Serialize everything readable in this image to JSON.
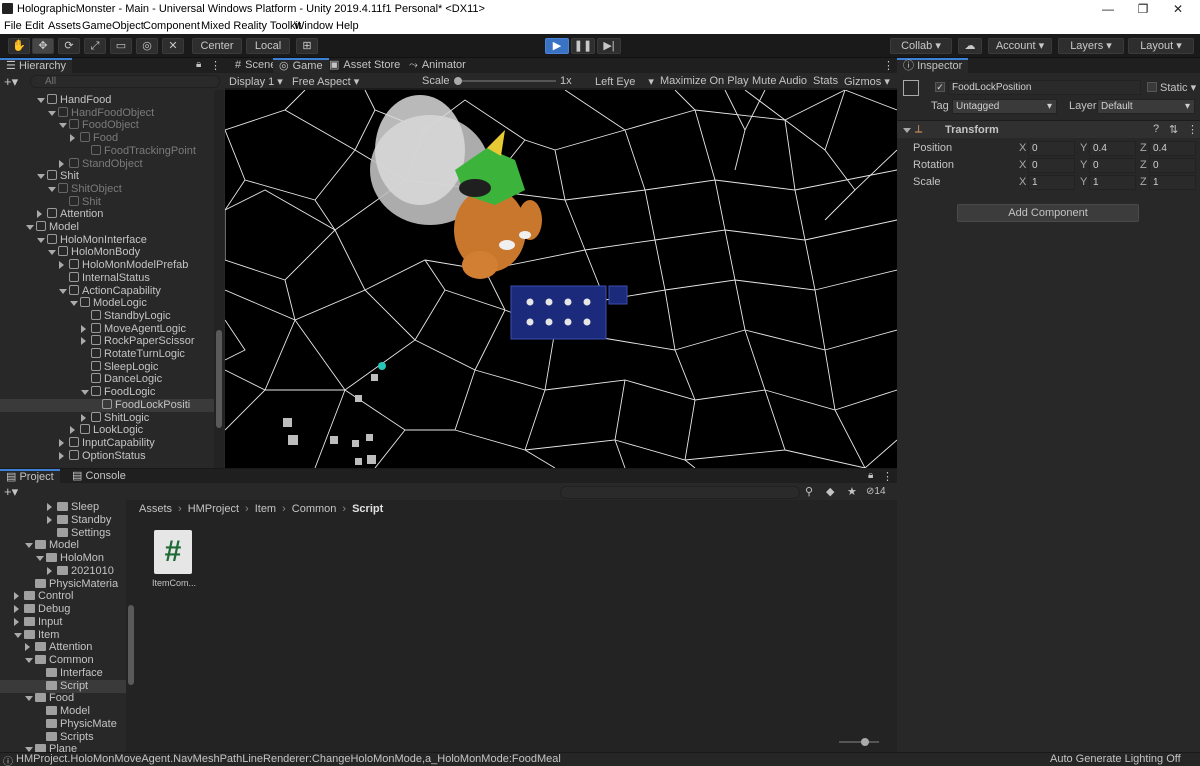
{
  "title_bar": {
    "text": "HolographicMonster - Main - Universal Windows Platform - Unity 2019.4.11f1 Personal* <DX11>",
    "minimize": "—",
    "maximize": "❐",
    "close": "✕"
  },
  "menu": [
    "File",
    "Edit",
    "Assets",
    "GameObject",
    "Component",
    "Mixed Reality Toolkit",
    "Window",
    "Help"
  ],
  "toolbar": {
    "pivot": "Center",
    "space": "Local",
    "collab": "Collab",
    "account": "Account",
    "layers": "Layers",
    "layout": "Layout"
  },
  "hierarchy": {
    "tab": "Hierarchy",
    "search_placeholder": "All",
    "add": "+",
    "rows": [
      {
        "label": "HandFood",
        "indent": 4,
        "arrow": "down",
        "dim": false
      },
      {
        "label": "HandFoodObject",
        "indent": 5,
        "arrow": "down",
        "dim": true
      },
      {
        "label": "FoodObject",
        "indent": 6,
        "arrow": "down",
        "dim": true
      },
      {
        "label": "Food",
        "indent": 7,
        "arrow": "right",
        "dim": true
      },
      {
        "label": "FoodTrackingPoint",
        "indent": 8,
        "arrow": "",
        "dim": true
      },
      {
        "label": "StandObject",
        "indent": 6,
        "arrow": "right",
        "dim": true
      },
      {
        "label": "Shit",
        "indent": 4,
        "arrow": "down",
        "dim": false
      },
      {
        "label": "ShitObject",
        "indent": 5,
        "arrow": "down",
        "dim": true
      },
      {
        "label": "Shit",
        "indent": 6,
        "arrow": "",
        "dim": true
      },
      {
        "label": "Attention",
        "indent": 4,
        "arrow": "right",
        "dim": false
      },
      {
        "label": "Model",
        "indent": 3,
        "arrow": "down",
        "dim": false
      },
      {
        "label": "HoloMonInterface",
        "indent": 4,
        "arrow": "down",
        "dim": false
      },
      {
        "label": "HoloMonBody",
        "indent": 5,
        "arrow": "down",
        "dim": false
      },
      {
        "label": "HoloMonModelPrefab",
        "indent": 6,
        "arrow": "right",
        "dim": false
      },
      {
        "label": "InternalStatus",
        "indent": 6,
        "arrow": "",
        "dim": false
      },
      {
        "label": "ActionCapability",
        "indent": 6,
        "arrow": "down",
        "dim": false
      },
      {
        "label": "ModeLogic",
        "indent": 7,
        "arrow": "down",
        "dim": false
      },
      {
        "label": "StandbyLogic",
        "indent": 8,
        "arrow": "",
        "dim": false
      },
      {
        "label": "MoveAgentLogic",
        "indent": 8,
        "arrow": "right",
        "dim": false
      },
      {
        "label": "RockPaperScissor",
        "indent": 8,
        "arrow": "right",
        "dim": false
      },
      {
        "label": "RotateTurnLogic",
        "indent": 8,
        "arrow": "",
        "dim": false
      },
      {
        "label": "SleepLogic",
        "indent": 8,
        "arrow": "",
        "dim": false
      },
      {
        "label": "DanceLogic",
        "indent": 8,
        "arrow": "",
        "dim": false
      },
      {
        "label": "FoodLogic",
        "indent": 8,
        "arrow": "down",
        "dim": false
      },
      {
        "label": "FoodLockPositi",
        "indent": 9,
        "arrow": "",
        "dim": false,
        "selected": true
      },
      {
        "label": "ShitLogic",
        "indent": 8,
        "arrow": "right",
        "dim": false
      },
      {
        "label": "LookLogic",
        "indent": 7,
        "arrow": "right",
        "dim": false
      },
      {
        "label": "InputCapability",
        "indent": 6,
        "arrow": "right",
        "dim": false
      },
      {
        "label": "OptionStatus",
        "indent": 6,
        "arrow": "right",
        "dim": false
      }
    ]
  },
  "scene_tabs": [
    {
      "label": "Scene",
      "icon": "#"
    },
    {
      "label": "Game",
      "icon": "◎",
      "active": true
    },
    {
      "label": "Asset Store",
      "icon": "▣"
    },
    {
      "label": "Animator",
      "icon": "⤳"
    }
  ],
  "game_toolbar": {
    "display": "Display 1",
    "aspect": "Free Aspect",
    "scale_label": "Scale",
    "scale_value": "1x",
    "eye": "Left Eye",
    "maximize": "Maximize On Play",
    "mute": "Mute Audio",
    "stats": "Stats",
    "gizmos": "Gizmos"
  },
  "inspector": {
    "tab": "Inspector",
    "object_name": "FoodLockPosition",
    "static_label": "Static",
    "tag_label": "Tag",
    "tag_value": "Untagged",
    "layer_label": "Layer",
    "layer_value": "Default",
    "component": "Transform",
    "rows": [
      {
        "label": "Position",
        "x": "0",
        "y": "0.4",
        "z": "0.4"
      },
      {
        "label": "Rotation",
        "x": "0",
        "y": "0",
        "z": "0"
      },
      {
        "label": "Scale",
        "x": "1",
        "y": "1",
        "z": "1"
      }
    ],
    "axis": {
      "x": "X",
      "y": "Y",
      "z": "Z"
    },
    "add_component": "Add Component"
  },
  "project": {
    "tabs": [
      {
        "label": "Project",
        "active": true
      },
      {
        "label": "Console"
      }
    ],
    "add": "+",
    "hidden_count": "14",
    "breadcrumb": [
      "Assets",
      "HMProject",
      "Item",
      "Common",
      "Script"
    ],
    "tree": [
      {
        "label": "Sleep",
        "indent": 4,
        "arrow": "right"
      },
      {
        "label": "Standby",
        "indent": 4,
        "arrow": "right"
      },
      {
        "label": "Settings",
        "indent": 4,
        "arrow": ""
      },
      {
        "label": "Model",
        "indent": 2,
        "arrow": "down"
      },
      {
        "label": "HoloMon",
        "indent": 3,
        "arrow": "down"
      },
      {
        "label": "2021010",
        "indent": 4,
        "arrow": "right"
      },
      {
        "label": "PhysicMateria",
        "indent": 2,
        "arrow": ""
      },
      {
        "label": "Control",
        "indent": 1,
        "arrow": "right"
      },
      {
        "label": "Debug",
        "indent": 1,
        "arrow": "right"
      },
      {
        "label": "Input",
        "indent": 1,
        "arrow": "right"
      },
      {
        "label": "Item",
        "indent": 1,
        "arrow": "down"
      },
      {
        "label": "Attention",
        "indent": 2,
        "arrow": "right"
      },
      {
        "label": "Common",
        "indent": 2,
        "arrow": "down"
      },
      {
        "label": "Interface",
        "indent": 3,
        "arrow": ""
      },
      {
        "label": "Script",
        "indent": 3,
        "arrow": "",
        "selected": true
      },
      {
        "label": "Food",
        "indent": 2,
        "arrow": "down"
      },
      {
        "label": "Model",
        "indent": 3,
        "arrow": ""
      },
      {
        "label": "PhysicMate",
        "indent": 3,
        "arrow": ""
      },
      {
        "label": "Scripts",
        "indent": 3,
        "arrow": ""
      },
      {
        "label": "Plane",
        "indent": 2,
        "arrow": "down"
      }
    ],
    "asset": {
      "label": "ItemCom...",
      "glyph": "#"
    }
  },
  "status_bar": {
    "message": "HMProject.HoloMonMoveAgent.NavMeshPathLineRenderer:ChangeHoloMonMode,a_HoloMonMode:FoodMeal",
    "right": "Auto Generate Lighting Off"
  }
}
